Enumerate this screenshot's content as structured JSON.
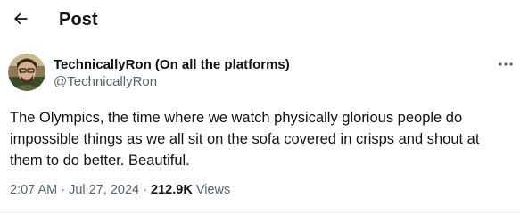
{
  "header": {
    "title": "Post",
    "back_icon": "arrow-left-icon"
  },
  "author": {
    "display_name": "TechnicallyRon (On all the platforms)",
    "handle": "@TechnicallyRon",
    "avatar_icon": "profile-photo"
  },
  "more_icon": "ellipsis-icon",
  "tweet": {
    "lines": [
      "The Olympics, the time where we watch physically glorious people do",
      "impossible things as we all sit on the sofa covered in crisps and shout at",
      "them to do better. Beautiful."
    ]
  },
  "meta": {
    "time": "2:07 AM",
    "separator": "·",
    "date": "Jul 27, 2024",
    "views_count": "212.9K",
    "views_label": "Views"
  },
  "colors": {
    "text": "#0f1419",
    "secondary": "#536471",
    "divider": "#eff3f4"
  }
}
